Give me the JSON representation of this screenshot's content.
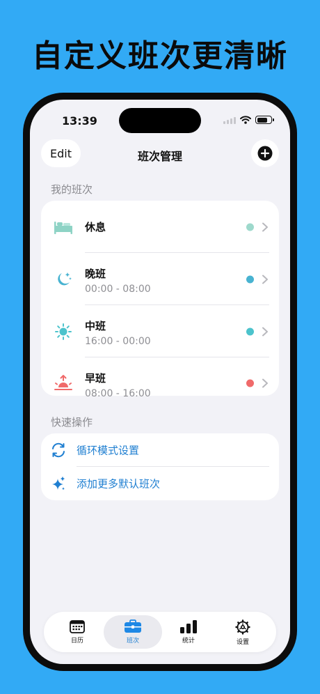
{
  "promo": {
    "headline": "自定义班次更清晰"
  },
  "status_bar": {
    "time": "13:39"
  },
  "nav": {
    "edit_label": "Edit",
    "title": "班次管理"
  },
  "my_shifts": {
    "title": "我的班次",
    "items": [
      {
        "name": "休息",
        "hours": "",
        "icon": "bed-icon",
        "color": "#9ED9CC"
      },
      {
        "name": "晚班",
        "hours": "00:00 - 08:00",
        "icon": "moon-stars-icon",
        "color": "#48B3D1"
      },
      {
        "name": "中班",
        "hours": "16:00 - 00:00",
        "icon": "sun-icon",
        "color": "#4CC3CC"
      },
      {
        "name": "早班",
        "hours": "08:00 - 16:00",
        "icon": "sunrise-icon",
        "color": "#F06A6A"
      }
    ]
  },
  "quick_actions": {
    "title": "快速操作",
    "items": [
      {
        "label": "循环模式设置",
        "icon": "cycle-arrows-icon"
      },
      {
        "label": "添加更多默认班次",
        "icon": "sparkles-icon"
      }
    ]
  },
  "tabbar": {
    "tabs": [
      {
        "label": "日历",
        "icon": "calendar-icon",
        "active": false
      },
      {
        "label": "班次",
        "icon": "briefcase-icon",
        "active": true
      },
      {
        "label": "统计",
        "icon": "bar-chart-icon",
        "active": false
      },
      {
        "label": "设置",
        "icon": "gear-icon",
        "active": false
      }
    ]
  },
  "colors": {
    "background": "#32AAF5",
    "accent": "#1F7FD1",
    "active_tab_icon": "#1E88E5"
  }
}
